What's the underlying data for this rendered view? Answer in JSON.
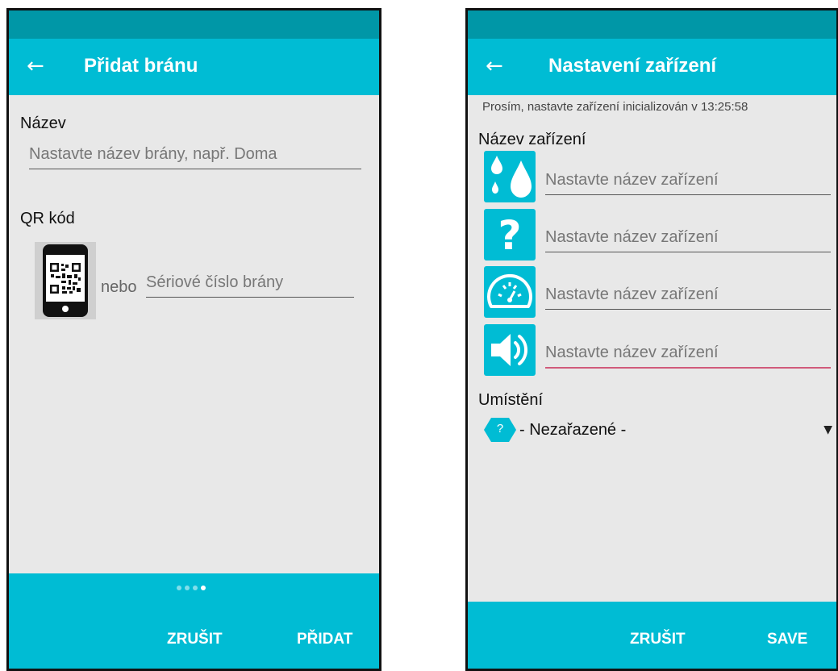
{
  "left_screen": {
    "app_bar": {
      "back_icon": "←",
      "title": "Přidat bránu"
    },
    "name_label": "Název",
    "name_input": {
      "placeholder": "Nastavte název brány, např. Doma",
      "value": ""
    },
    "qr_label": "QR kód",
    "qr_icon": "phone-qr-icon",
    "or_text": "nebo",
    "serial_input": {
      "placeholder": "Sériové číslo brány",
      "value": ""
    },
    "pager": {
      "pages": 4,
      "current": 4
    },
    "actions": {
      "cancel": "ZRUŠIT",
      "add": "PŘIDAT"
    }
  },
  "right_screen": {
    "app_bar": {
      "back_icon": "←",
      "title": "Nastavení zařízení"
    },
    "info_text": "Prosím, nastavte zařízení inicializován v 13:25:58",
    "device_name_label": "Název zařízení",
    "devices": [
      {
        "icon": "water-drops-icon",
        "placeholder": "Nastavte název zařízení"
      },
      {
        "icon": "question-mark-icon",
        "placeholder": "Nastavte název zařízení"
      },
      {
        "icon": "gauge-icon",
        "placeholder": "Nastavte název zařízení"
      },
      {
        "icon": "speaker-icon",
        "placeholder": "Nastavte název zařízení"
      }
    ],
    "location_label": "Umístění",
    "location_select": {
      "badge": "?",
      "value": "- Nezařazené -",
      "arrow": "▼"
    },
    "actions": {
      "cancel": "ZRUŠIT",
      "save": "SAVE"
    }
  },
  "colors": {
    "primary": "#00bcd4",
    "primary_dark": "#0097a7",
    "background": "#e8e8e8",
    "focus_underline": "#d15a7b"
  }
}
